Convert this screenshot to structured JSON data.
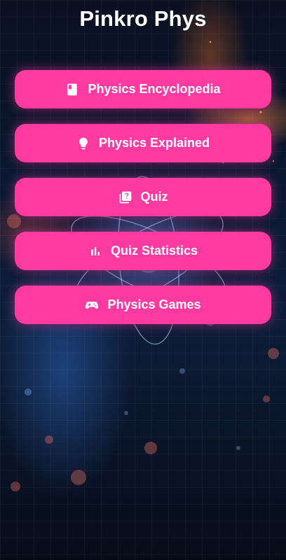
{
  "app": {
    "title": "Pinkro Phys"
  },
  "menu": {
    "items": [
      {
        "label": "Physics Encyclopedia",
        "icon": "book-icon"
      },
      {
        "label": "Physics Explained",
        "icon": "lightbulb-icon"
      },
      {
        "label": "Quiz",
        "icon": "quiz-icon"
      },
      {
        "label": "Quiz Statistics",
        "icon": "bar-chart-icon"
      },
      {
        "label": "Physics Games",
        "icon": "gamepad-icon"
      }
    ]
  },
  "colors": {
    "button": "#ff3aa0",
    "text": "#ffffff",
    "background": "#0b1830"
  }
}
